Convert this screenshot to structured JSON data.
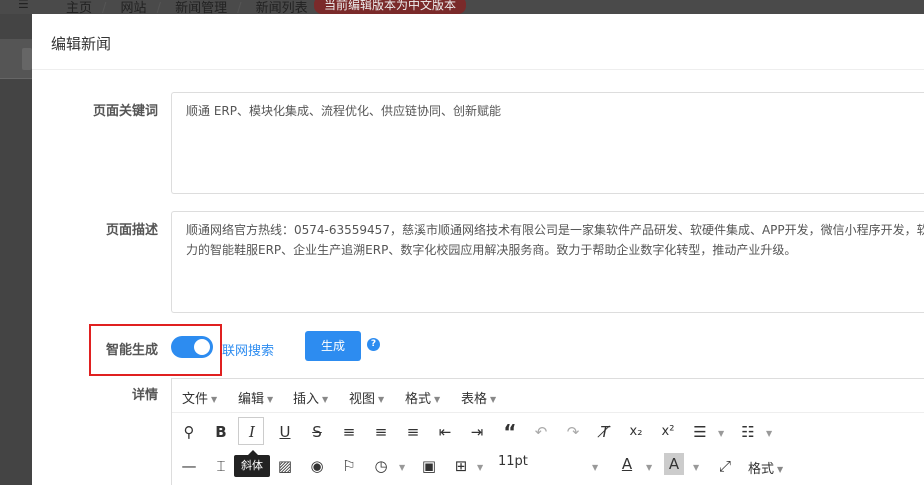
{
  "background": {
    "breadcrumb": [
      "主页",
      "网站",
      "新闻管理",
      "新闻列表"
    ],
    "badge": "当前编辑版本为中文版本"
  },
  "modal": {
    "title": "编辑新闻",
    "keywords": {
      "label": "页面关键词",
      "value": "顺通 ERP、模块化集成、流程优化、供应链协同、创新赋能"
    },
    "description": {
      "label": "页面描述",
      "line1": "顺通网络官方热线：0574-63559457，慈溪市顺通网络技术有限公司是一家集软件产品研发、软硬件集成、APP开发，微信小程序开发，软",
      "line2": "力的智能鞋服ERP、企业生产追溯ERP、数字化校园应用解决服务商。致力于帮助企业数字化转型，推动产业升级。"
    },
    "smart": {
      "label": "智能生成",
      "toggle_on": true,
      "link": "联网搜索",
      "button": "生成"
    },
    "details": {
      "label": "详情",
      "menus": [
        "文件",
        "编辑",
        "插入",
        "视图",
        "格式",
        "表格"
      ],
      "tooltip": "斜体",
      "font_size": "11pt",
      "format_label": "格式"
    }
  },
  "colors": {
    "accent": "#2d8cf0",
    "highlight": "#e02020"
  }
}
